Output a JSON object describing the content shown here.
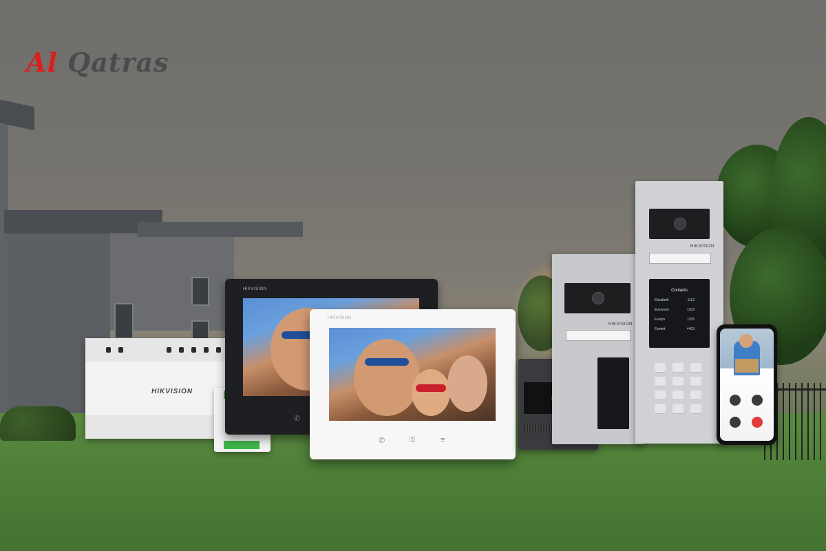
{
  "brand": {
    "logo_part1": "Al",
    "logo_part2": "Qatras",
    "logo_color_red": "#d8201f",
    "logo_color_gray": "#4a4b4d"
  },
  "products": {
    "distributor_brand": "HIKVISION",
    "monitor_brand": "HIKVISION",
    "door_station_brand": "HIKVISION",
    "lcd_header": "Contacts",
    "lcd_contacts": [
      {
        "name": "Elizabeth",
        "room": "1112"
      },
      {
        "name": "Everyone",
        "room": "1103"
      },
      {
        "name": "Evelyn",
        "room": "1105"
      },
      {
        "name": "Evelett",
        "room": "4403"
      }
    ]
  },
  "scene": {
    "sky_color": "#76746f",
    "lawn_color": "#4f8038",
    "sunset_glow": "#f2b24a"
  }
}
